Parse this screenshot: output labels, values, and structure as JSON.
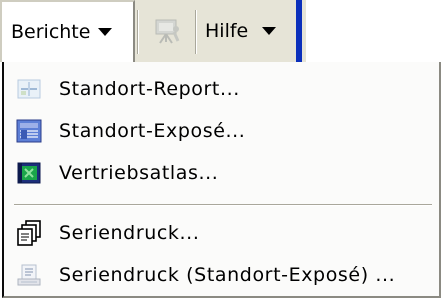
{
  "toolbar": {
    "berichte_label": "Berichte",
    "hilfe_label": "Hilfe",
    "disabled_icon": "presentation-icon"
  },
  "menu": {
    "items": [
      {
        "label": "Standort-Report...",
        "icon": "report-document-icon"
      },
      {
        "label": "Standort-Exposé...",
        "icon": "expose-image-icon"
      },
      {
        "label": "Vertriebsatlas...",
        "icon": "atlas-book-icon"
      },
      {
        "label": "Seriendruck...",
        "icon": "serial-print-pages-icon"
      },
      {
        "label": "Seriendruck (Standort-Exposé) ...",
        "icon": "serial-print-document-icon"
      }
    ]
  },
  "colors": {
    "toolbar_bg": "#e6e4d7",
    "menu_bg": "#fbfbfa",
    "active_handle": "#0b2fbb"
  }
}
